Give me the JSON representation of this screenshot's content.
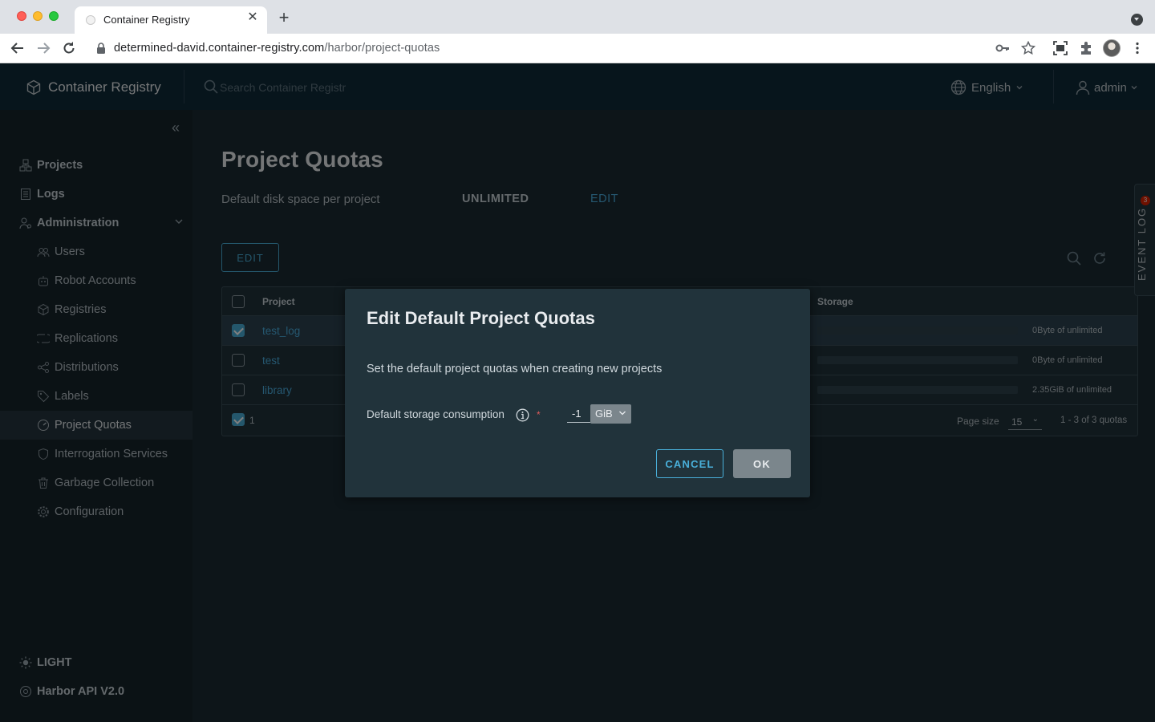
{
  "browser": {
    "tab_title": "Container Registry",
    "url_host": "determined-david.container-registry.com",
    "url_path": "/harbor/project-quotas"
  },
  "header": {
    "brand": "Container Registry",
    "search_placeholder": "Search Container Registr",
    "language": "English",
    "user": "admin"
  },
  "sidebar": {
    "items": [
      {
        "label": "Projects",
        "icon": "projects-icon"
      },
      {
        "label": "Logs",
        "icon": "logs-icon"
      },
      {
        "label": "Administration",
        "icon": "administration-icon"
      }
    ],
    "admin_items": [
      {
        "label": "Users"
      },
      {
        "label": "Robot Accounts"
      },
      {
        "label": "Registries"
      },
      {
        "label": "Replications"
      },
      {
        "label": "Distributions"
      },
      {
        "label": "Labels"
      },
      {
        "label": "Project Quotas",
        "active": true
      },
      {
        "label": "Interrogation Services"
      },
      {
        "label": "Garbage Collection"
      },
      {
        "label": "Configuration"
      }
    ],
    "theme_toggle": "LIGHT",
    "api_link": "Harbor API V2.0"
  },
  "page": {
    "title": "Project Quotas",
    "default_label": "Default disk space per project",
    "default_value": "UNLIMITED",
    "default_edit": "EDIT",
    "edit_button": "EDIT"
  },
  "grid": {
    "columns": {
      "project": "Project",
      "storage": "Storage"
    },
    "rows": [
      {
        "project": "test_log",
        "storage": "0Byte of unlimited",
        "selected": true
      },
      {
        "project": "test",
        "storage": "0Byte of unlimited",
        "selected": false
      },
      {
        "project": "library",
        "storage": "2.35GiB of unlimited",
        "selected": false
      }
    ],
    "footer": {
      "selected_count": "1",
      "page_size_label": "Page size",
      "page_size": "15",
      "pager": "1 - 3 of 3 quotas"
    }
  },
  "event_log": {
    "label": "EVENT LOG",
    "badge": "3"
  },
  "modal": {
    "title": "Edit Default Project Quotas",
    "description": "Set the default project quotas when creating new projects",
    "field_label": "Default storage consumption",
    "required_mark": "*",
    "quota_value": "-1",
    "unit": "GiB",
    "cancel": "CANCEL",
    "ok": "OK"
  }
}
